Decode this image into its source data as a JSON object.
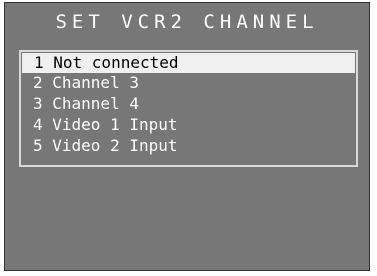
{
  "screen": {
    "title": "SET VCR2 CHANNEL"
  },
  "menu": {
    "items": [
      {
        "label": "1 Not connected",
        "selected": true
      },
      {
        "label": "2 Channel 3",
        "selected": false
      },
      {
        "label": "3 Channel 4",
        "selected": false
      },
      {
        "label": "4 Video 1 Input",
        "selected": false
      },
      {
        "label": "5 Video 2 Input",
        "selected": false
      }
    ]
  },
  "colors": {
    "background": "#777777",
    "text": "#ffffff",
    "highlight": "#f0f0f0",
    "highlight_text": "#000000"
  }
}
